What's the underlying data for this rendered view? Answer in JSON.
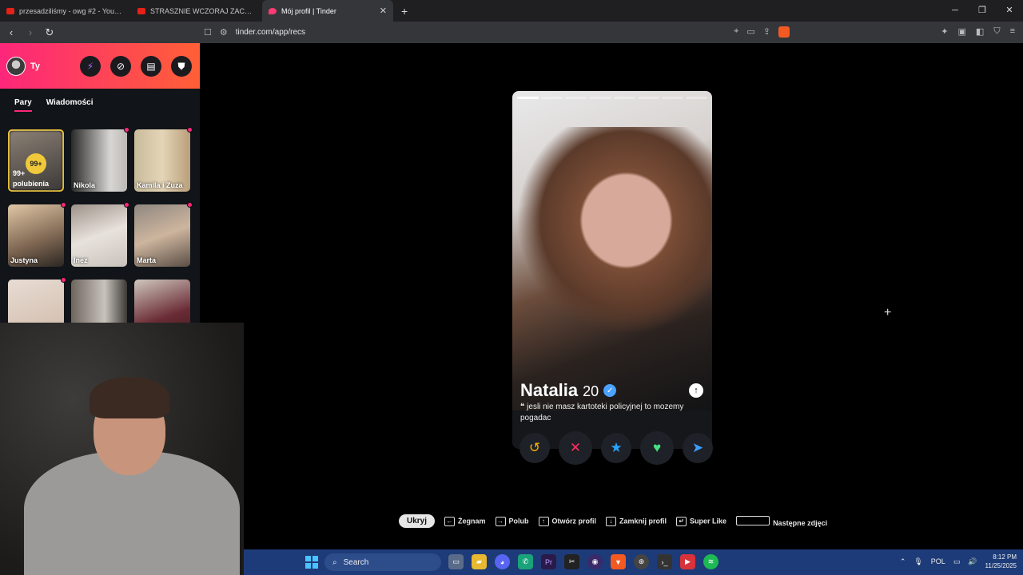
{
  "browser": {
    "tabs": [
      {
        "title": "przesadziliśmy - owg #2 - YouTube",
        "active": false
      },
      {
        "title": "STRASZNIE WCZORAJ ZACHLALIŚMY",
        "active": false
      },
      {
        "title": "Mój profil | Tinder",
        "active": true
      }
    ],
    "new_tab": "+",
    "url": "tinder.com/app/recs"
  },
  "sidebar": {
    "user_label": "Ty",
    "tabs": [
      {
        "label": "Pary",
        "active": true
      },
      {
        "label": "Wiadomości",
        "active": false
      }
    ],
    "likes_card": {
      "badge": "99+",
      "line1": "99+",
      "line2": "polubienia"
    },
    "matches": [
      {
        "name": "Nikola",
        "dot": true
      },
      {
        "name": "Kamila i Zuza",
        "dot": true
      },
      {
        "name": "Justyna",
        "dot": true
      },
      {
        "name": "Inez",
        "dot": true
      },
      {
        "name": "Marta",
        "dot": true
      },
      {
        "name": "",
        "dot": true
      },
      {
        "name": "",
        "dot": false
      },
      {
        "name": "",
        "dot": false
      }
    ]
  },
  "profile": {
    "name": "Natalia",
    "age": "20",
    "bio": "jesli nie masz kartoteki policyjnej to mozemy pogadac",
    "photo_count": 8,
    "current_photo": 1
  },
  "shortcuts": {
    "hide": "Ukryj",
    "nope": "Żegnam",
    "like": "Polub",
    "open": "Otwórz profil",
    "close": "Zamknij profil",
    "superlike": "Super Like",
    "next": "Następne zdjęci"
  },
  "taskbar": {
    "search": "Search",
    "lang": "POL",
    "time": "8:12 PM",
    "date": "11/25/2025"
  },
  "colors": {
    "tinder_gradient_start": "#fd267a",
    "tinder_gradient_end": "#ff6036",
    "likes_gold": "#f0c93b",
    "taskbar": "#1d3b78"
  }
}
